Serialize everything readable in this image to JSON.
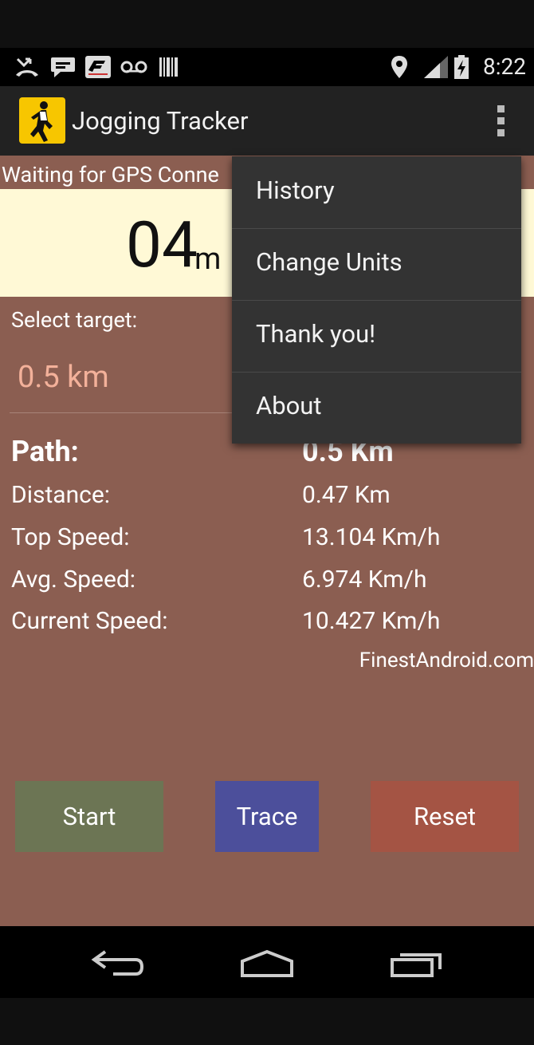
{
  "status_bar": {
    "time": "8:22",
    "icons": [
      "missed-call-icon",
      "chat-icon",
      "f1-app-icon",
      "voicemail-icon",
      "barcode-icon",
      "location-icon",
      "signal-icon",
      "battery-charging-icon"
    ]
  },
  "action_bar": {
    "title": "Jogging Tracker",
    "app_icon": "jogger-icon",
    "overflow_icon": "overflow-menu-icon"
  },
  "main": {
    "gps_status": "Waiting for GPS Conne",
    "timer": {
      "minutes": "04",
      "unit": "m"
    },
    "select_target_label": "Select target:",
    "target_value": "0.5 km",
    "stats": {
      "path_label": "Path:",
      "path_value": "0.5 Km",
      "distance_label": "Distance:",
      "distance_value": "0.47 Km",
      "top_speed_label": "Top Speed:",
      "top_speed_value": "13.104 Km/h",
      "avg_speed_label": "Avg. Speed:",
      "avg_speed_value": "6.974 Km/h",
      "current_speed_label": "Current Speed:",
      "current_speed_value": "10.427 Km/h"
    },
    "credit": "FinestAndroid.com",
    "buttons": {
      "start": "Start",
      "trace": "Trace",
      "reset": "Reset"
    }
  },
  "menu": {
    "items": [
      {
        "label": "History"
      },
      {
        "label": "Change Units"
      },
      {
        "label": "Thank you!"
      },
      {
        "label": "About"
      }
    ]
  },
  "nav_bar": {
    "icons": [
      "back-icon",
      "home-icon",
      "recents-icon"
    ]
  },
  "colors": {
    "content_bg": "#8b5e51",
    "timer_bg": "#fff9d6",
    "start": "#6c7554",
    "trace": "#4c4f9b",
    "reset": "#a45444",
    "target_text": "#f3b19a"
  }
}
